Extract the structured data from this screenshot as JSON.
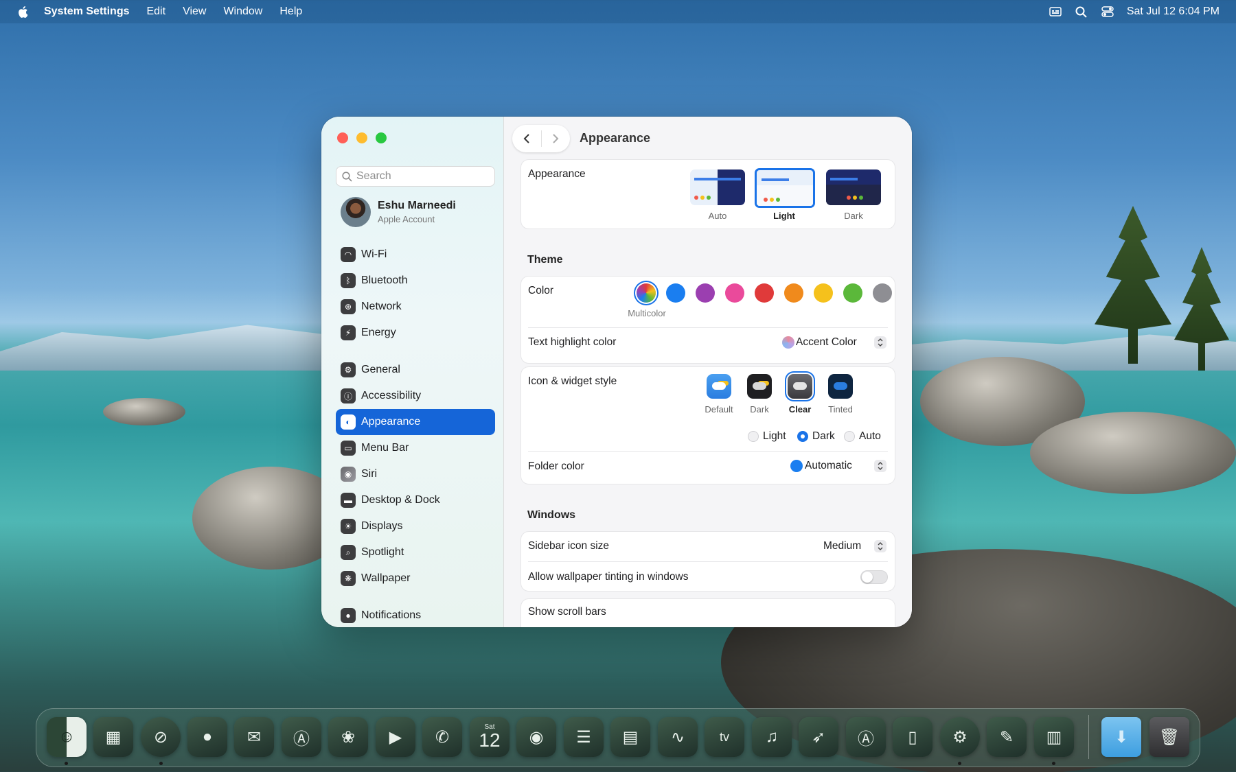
{
  "menubar": {
    "app_name": "System Settings",
    "menus": [
      "Edit",
      "View",
      "Window",
      "Help"
    ],
    "datetime": "Sat Jul 12  6:04 PM",
    "status_icons": [
      "keyboard-caption-icon",
      "search-icon",
      "control-center-icon"
    ]
  },
  "sidebar": {
    "search_placeholder": "Search",
    "account": {
      "name": "Eshu Marneedi",
      "subtitle": "Apple Account"
    },
    "items": [
      {
        "label": "Wi-Fi",
        "icon": "wifi-icon"
      },
      {
        "label": "Bluetooth",
        "icon": "bluetooth-icon"
      },
      {
        "label": "Network",
        "icon": "globe-icon"
      },
      {
        "label": "Energy",
        "icon": "bolt-icon"
      },
      {
        "label": "General",
        "icon": "gear-icon"
      },
      {
        "label": "Accessibility",
        "icon": "accessibility-icon"
      },
      {
        "label": "Appearance",
        "icon": "appearance-icon",
        "selected": true
      },
      {
        "label": "Menu Bar",
        "icon": "menubar-icon"
      },
      {
        "label": "Siri",
        "icon": "siri-icon"
      },
      {
        "label": "Desktop & Dock",
        "icon": "dock-icon"
      },
      {
        "label": "Displays",
        "icon": "sun-icon"
      },
      {
        "label": "Spotlight",
        "icon": "magnifier-icon"
      },
      {
        "label": "Wallpaper",
        "icon": "flower-icon"
      },
      {
        "label": "Notifications",
        "icon": "bell-icon"
      }
    ]
  },
  "main": {
    "title": "Appearance",
    "appearance": {
      "label": "Appearance",
      "options": [
        "Auto",
        "Light",
        "Dark"
      ],
      "selected": "Light"
    },
    "theme": {
      "section": "Theme",
      "color_label": "Color",
      "color_selected_caption": "Multicolor",
      "colors": [
        "#multicolor",
        "#1a7ef0",
        "#9b3fb0",
        "#ea4a9b",
        "#e03a3a",
        "#f08a1c",
        "#f5c11c",
        "#5bb83a",
        "#8e8e93"
      ],
      "highlight_label": "Text highlight color",
      "highlight_value": "Accent Color",
      "icon_label": "Icon & widget style",
      "icon_options": [
        "Default",
        "Dark",
        "Clear",
        "Tinted"
      ],
      "icon_selected": "Clear",
      "radios": [
        "Light",
        "Dark",
        "Auto"
      ],
      "radio_selected": "Dark",
      "folder_label": "Folder color",
      "folder_value": "Automatic"
    },
    "windows": {
      "section": "Windows",
      "sidebar_icon_label": "Sidebar icon size",
      "sidebar_icon_value": "Medium",
      "tinting_label": "Allow wallpaper tinting in windows",
      "tinting_on": false,
      "scrollbars_label": "Show scroll bars"
    }
  },
  "dock": {
    "apps": [
      "Finder",
      "Launchpad",
      "Safari",
      "Messages",
      "Mail",
      "Maps",
      "Photos",
      "FaceTime",
      "Phone",
      "Calendar",
      "Contacts",
      "Reminders",
      "Notes",
      "Freeform",
      "TV",
      "Music",
      "Rocket",
      "App Store",
      "iPhone Mirroring",
      "System Settings",
      "Script Editor",
      "News",
      "Downloads",
      "Trash"
    ],
    "calendar_day": "Sat",
    "calendar_date": "12"
  }
}
